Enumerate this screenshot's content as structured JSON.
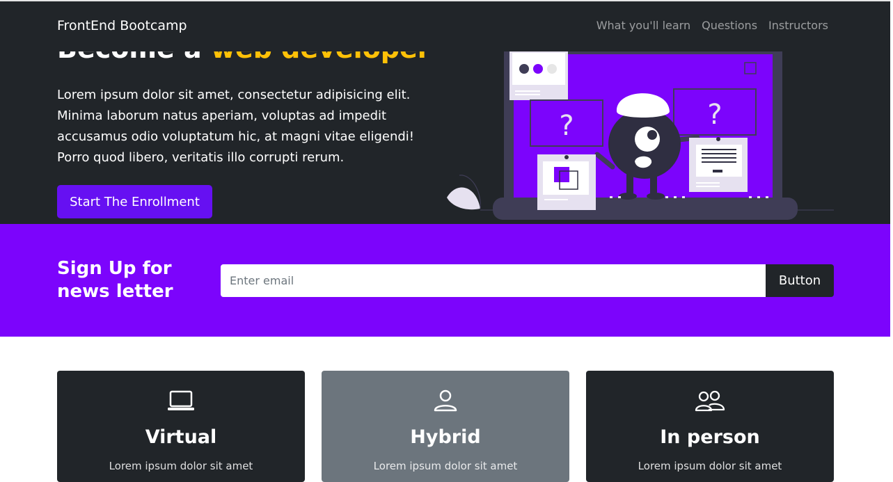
{
  "navbar": {
    "brand": "FrontEnd Bootcamp",
    "links": [
      "What you'll learn",
      "Questions",
      "Instructors"
    ]
  },
  "hero": {
    "title_prefix": "Become a",
    "title_accent": "web developer",
    "text": "Lorem ipsum dolor sit amet, consectetur adipisicing elit. Minima laborum natus aperiam, voluptas ad impedit accusamus odio voluptatum hic, at magni vitae eligendi! Porro quod libero, veritatis illo corrupti rerum.",
    "cta_label": "Start The Enrollment",
    "illustration_marks": [
      "?",
      "?"
    ]
  },
  "newsletter": {
    "title": "Sign Up for news letter",
    "email_placeholder": "Enter email",
    "button_label": "Button"
  },
  "cards": [
    {
      "icon": "laptop-icon",
      "title": "Virtual",
      "text": "Lorem ipsum dolor sit amet"
    },
    {
      "icon": "person-icon",
      "title": "Hybrid",
      "text": "Lorem ipsum dolor sit amet"
    },
    {
      "icon": "people-icon",
      "title": "In person",
      "text": "Lorem ipsum dolor sit amet"
    }
  ],
  "colors": {
    "dark": "#212529",
    "primary_purple": "#6610f2",
    "newsletter_purple": "#7c04fc",
    "accent_yellow": "#ffc107",
    "secondary_gray": "#6c757d"
  }
}
